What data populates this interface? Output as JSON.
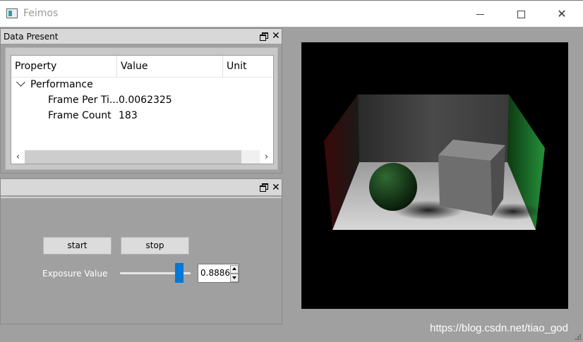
{
  "window": {
    "title": "Feimos",
    "icon": "app-window-icon",
    "controls": [
      "minimize-icon",
      "maximize-icon",
      "close-icon"
    ]
  },
  "dock1": {
    "title": "Data Present",
    "tree": {
      "columns": [
        "Property",
        "Value",
        "Unit"
      ],
      "group": "Performance",
      "rows": [
        {
          "property": "Frame Per Ti...",
          "value": "0.0062325",
          "unit": ""
        },
        {
          "property": "Frame Count",
          "value": "183",
          "unit": ""
        }
      ],
      "scroll_left": "‹",
      "scroll_right": "›"
    }
  },
  "dock2": {
    "title": "",
    "start_label": "start",
    "stop_label": "stop",
    "exposure_label": "Exposure Value",
    "exposure_value": "0.8886",
    "slider_level": 0.8886
  },
  "render": {
    "description_colors": {
      "background": "#000000",
      "left_wall": "#5a1010",
      "right_wall": "#1e7a28",
      "floor": "#d0d0d0"
    }
  },
  "watermark": "https://blog.csdn.net/tiao_god"
}
